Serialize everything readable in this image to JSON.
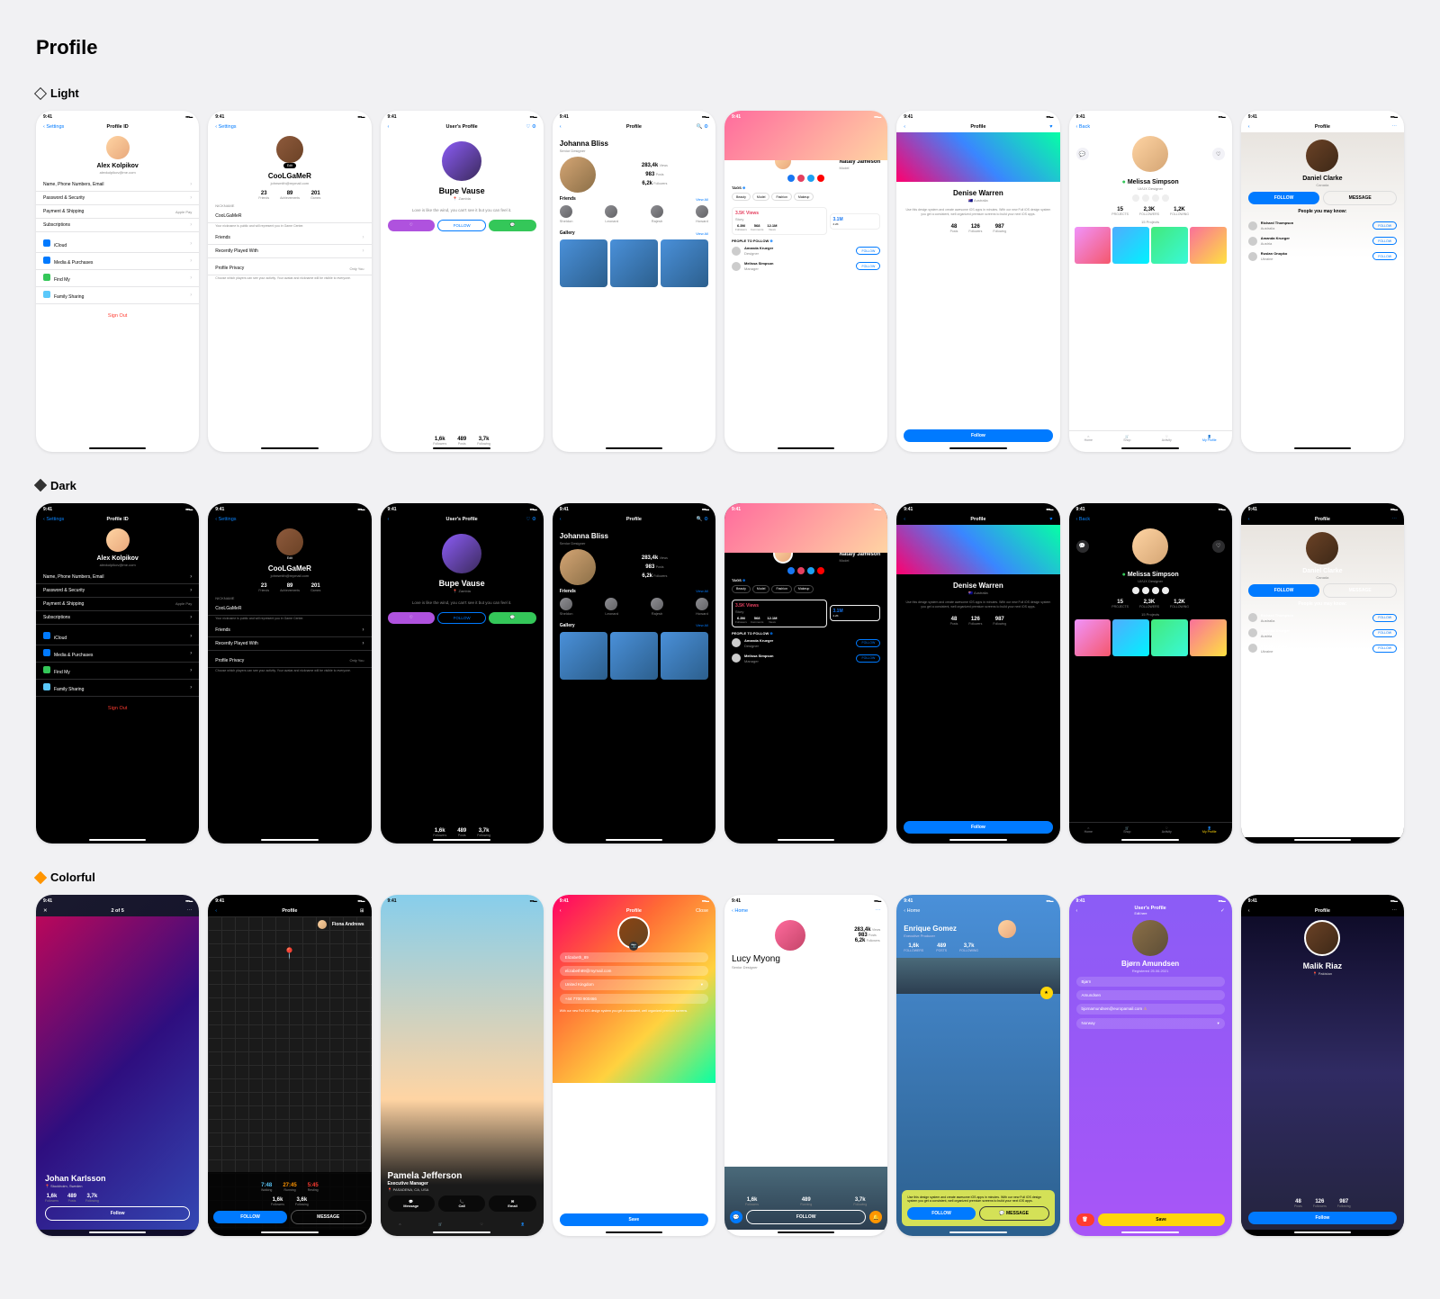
{
  "page_title": "Profile",
  "sections": {
    "light": "Light",
    "dark": "Dark",
    "colorful": "Colorful"
  },
  "status_time": "9:41",
  "nav": {
    "settings": "Settings",
    "profile_id": "Profile ID",
    "users_profile": "User's Profile",
    "profile": "Profile",
    "back": "Back",
    "home": "Home",
    "close": "Close"
  },
  "p1": {
    "name": "Alex Kolpikov",
    "email": "alexkolpikov@me.com",
    "items": [
      "Name, Phone Numbers, Email",
      "Password & Security",
      "Payment & Shipping",
      "Subscriptions"
    ],
    "pay_hint": "Apple Pay",
    "services": [
      "iCloud",
      "Media & Purchases",
      "Find My",
      "Family Sharing"
    ],
    "signout": "Sign Out"
  },
  "p2": {
    "name": "CooLGaMeR",
    "email": "johnsmith@mymail.com",
    "edit": "Edit",
    "stats": [
      {
        "v": "23",
        "l": "Friends"
      },
      {
        "v": "89",
        "l": "Achievements"
      },
      {
        "v": "201",
        "l": "Games"
      }
    ],
    "nickname_hdr": "NICKNAME",
    "nickname": "CooLGaMeR",
    "nickname_sub": "Your nickname is public and will represent you in Game Center.",
    "friends": "Friends",
    "recent": "Recently Played With",
    "privacy": "Profile Privacy",
    "privacy_val": "Only You",
    "privacy_sub": "Choose which players can see your activity. Your avatar and nickname will be visible to everyone."
  },
  "p3": {
    "name": "Bupe Vause",
    "loc": "Zambia",
    "quote": "Love is like the wind, you can't see it but you can feel it.",
    "follow": "FOLLOW",
    "stats": [
      {
        "v": "1,6k",
        "l": "Followers"
      },
      {
        "v": "489",
        "l": "Posts"
      },
      {
        "v": "3,7k",
        "l": "Following"
      }
    ]
  },
  "p4": {
    "name": "Johanna Bliss",
    "role": "Senior Designer",
    "stats": [
      {
        "v": "283,4k",
        "l": "Views"
      },
      {
        "v": "983",
        "l": "Posts"
      },
      {
        "v": "6,2k",
        "l": "Followers"
      }
    ],
    "friends_hdr": "Friends",
    "view_all": "View All",
    "friend_names": [
      "Sheldon",
      "Leonard",
      "Rajesh",
      "Howard"
    ],
    "gallery_hdr": "Gallery"
  },
  "p5": {
    "name": "Nataly Jameson",
    "role": "Model",
    "tags_hdr": "TAGS",
    "tags": [
      "Beauty",
      "Model",
      "Fashion",
      "Makeup"
    ],
    "views": "3.5K Views",
    "views_sub": "Story",
    "ig": [
      {
        "v": "6.3M",
        "l": "Followers"
      },
      {
        "v": "568",
        "l": "Comments"
      },
      {
        "v": "12.1M",
        "l": "Views"
      }
    ],
    "fb": [
      {
        "v": "3.1M",
        "l": ""
      },
      {
        "v": "2.2K",
        "l": ""
      }
    ],
    "ppl_hdr": "PEOPLE TO FOLLOW",
    "ppl": [
      {
        "n": "Amanda Krueger",
        "s": "Designer"
      },
      {
        "n": "Melissa Simpson",
        "s": "Manager"
      }
    ],
    "follow": "FOLLOW"
  },
  "p6": {
    "name": "Denise Warren",
    "loc": "Australia",
    "desc": "Use this design system and create awesome iOS apps in minutes. With our new Full iOS design system you get a consistent, well organized premium screens to build your next iOS apps.",
    "stats": [
      {
        "v": "48",
        "l": "Posts"
      },
      {
        "v": "126",
        "l": "Followers"
      },
      {
        "v": "987",
        "l": "Following"
      }
    ],
    "follow": "Follow"
  },
  "p7": {
    "name": "Melissa Simpson",
    "role": "UI/UX Designer",
    "dot": "●",
    "stats": [
      {
        "v": "15",
        "l": "PROJECTS"
      },
      {
        "v": "2,3K",
        "l": "FOLLOWERS"
      },
      {
        "v": "1,2K",
        "l": "FOLLOWING"
      }
    ],
    "proj_hdr": "15 Projects",
    "tabs": [
      "Home",
      "Shop",
      "Activity",
      "My Profile"
    ]
  },
  "p8": {
    "name": "Daniel Clarke",
    "loc": "Canada",
    "follow": "FOLLOW",
    "message": "MESSAGE",
    "ppl_hdr": "People you may know:",
    "ppl": [
      {
        "n": "Richard Thompson",
        "s": "Australia"
      },
      {
        "n": "Amanda Krueger",
        "s": "Austria"
      },
      {
        "n": "Ruslan Onopko",
        "s": "Ukraine"
      }
    ],
    "fbtn": "FOLLOW"
  },
  "c1": {
    "name": "Johan Karlsson",
    "loc": "Stockholm, Sweden",
    "counter": "2 of 5",
    "stats": [
      {
        "v": "1,6k",
        "l": "Followers"
      },
      {
        "v": "489",
        "l": "Posts"
      },
      {
        "v": "3,7k",
        "l": "Following"
      }
    ],
    "follow": "Follow"
  },
  "c2": {
    "name": "Fiona Andrews",
    "tstats": [
      {
        "v": "7:48",
        "l": "Walking"
      },
      {
        "v": "27:45",
        "l": "Running"
      },
      {
        "v": "5:45",
        "l": "Resting"
      }
    ],
    "bstats": [
      {
        "v": "1,6k",
        "l": "Followers"
      },
      {
        "v": "3,6k",
        "l": "Following"
      }
    ],
    "follow": "FOLLOW",
    "message": "MESSAGE"
  },
  "c3": {
    "name": "Pamela Jefferson",
    "role": "Executive Manager",
    "loc": "PASADENA, CA, USA",
    "actions": [
      "Message",
      "Call",
      "Email"
    ],
    "tabs": [
      "Home",
      "Shop",
      "Activity",
      "My Profile"
    ]
  },
  "c4": {
    "fields": {
      "username": "Elizabeth_89",
      "email": "elizabeth89@mymail.com",
      "country": "United Kingdom",
      "phone": "+44 7700 900466"
    },
    "desc": "With our new Full iOS design system you get a consistent, well organized premium screens.",
    "save": "Save"
  },
  "c5": {
    "name": "Lucy Myong",
    "role": "Senior Designer",
    "stats": [
      {
        "v": "283,4k",
        "l": "Views"
      },
      {
        "v": "983",
        "l": "Posts"
      },
      {
        "v": "6,2k",
        "l": "Followers"
      }
    ],
    "bstats": [
      {
        "v": "1,6k",
        "l": "Followers"
      },
      {
        "v": "489",
        "l": "Running"
      },
      {
        "v": "3,7k",
        "l": "Following"
      }
    ],
    "follow": "FOLLOW"
  },
  "c6": {
    "name": "Enrique Gomez",
    "role": "Executive Producer",
    "stats": [
      {
        "v": "1,6k",
        "l": "FOLLOWERS"
      },
      {
        "v": "489",
        "l": "POSTS"
      },
      {
        "v": "3,7k",
        "l": "FOLLOWING"
      }
    ],
    "desc": "Use this design system and create awesome iOS apps in minutes. With our new Full iOS design system you get a consistent, well organized premium screens to build your next iOS apps.",
    "follow": "FOLLOW",
    "message": "MESSAGE"
  },
  "c7": {
    "name": "Bjørn Amundsen",
    "reg": "Registered 25.06.2021",
    "sub": "Edit here",
    "fields": {
      "first": "Bjørn",
      "last": "Amundsen",
      "email": "bjornamundsen@europamail.com",
      "country": "Norway"
    },
    "save": "Save"
  },
  "c8": {
    "name": "Malik Riaz",
    "loc": "Pakistan",
    "stats": [
      {
        "v": "48",
        "l": "Posts"
      },
      {
        "v": "126",
        "l": "Followers"
      },
      {
        "v": "987",
        "l": "Following"
      }
    ],
    "follow": "Follow"
  }
}
